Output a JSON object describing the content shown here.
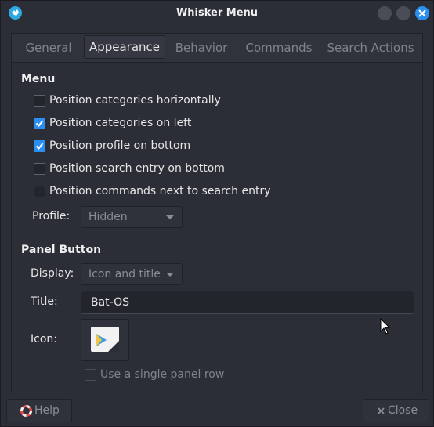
{
  "window": {
    "title": "Whisker Menu"
  },
  "tabs": [
    {
      "label": "General"
    },
    {
      "label": "Appearance"
    },
    {
      "label": "Behavior"
    },
    {
      "label": "Commands"
    },
    {
      "label": "Search Actions"
    }
  ],
  "menu_section": {
    "title": "Menu",
    "options": [
      {
        "label": "Position categories horizontally",
        "checked": false
      },
      {
        "label": "Position categories on left",
        "checked": true
      },
      {
        "label": "Position profile on bottom",
        "checked": true
      },
      {
        "label": "Position search entry on bottom",
        "checked": false
      },
      {
        "label": "Position commands next to search entry",
        "checked": false
      }
    ],
    "profile_label": "Profile:",
    "profile_value": "Hidden"
  },
  "panel_section": {
    "title": "Panel Button",
    "display_label": "Display:",
    "display_value": "Icon and title",
    "title_label": "Title:",
    "title_value": "Bat-OS",
    "icon_label": "Icon:",
    "single_row_label": "Use a single panel row",
    "single_row_checked": false
  },
  "footer": {
    "help_label": "Help",
    "close_label": "Close"
  },
  "colors": {
    "accent": "#2a8ff0",
    "background": "#2b2e37"
  }
}
